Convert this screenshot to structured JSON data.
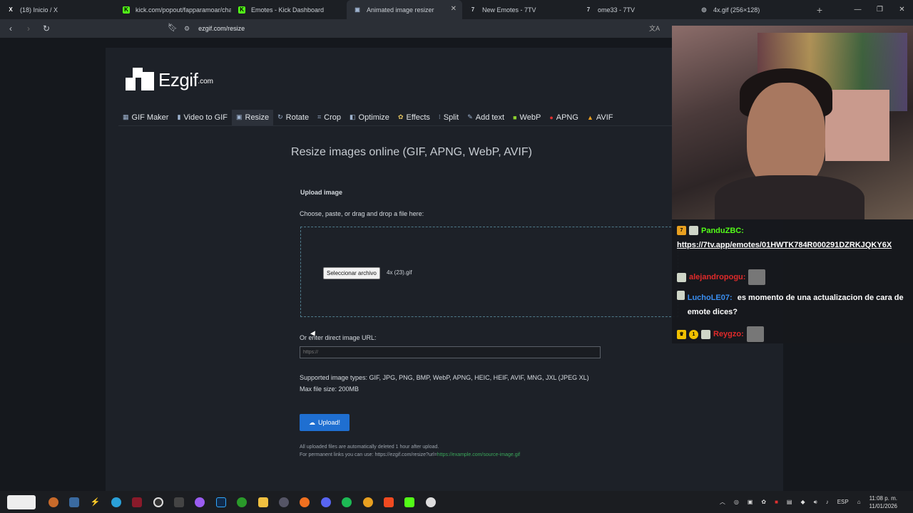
{
  "tabs": [
    {
      "label": "(18) Inicio / X",
      "favicon": "X",
      "color": "#ffffff"
    },
    {
      "label": "kick.com/popout/fapparamoar/chat",
      "favicon": "K",
      "color": "#53fc18"
    },
    {
      "label": "Emotes - Kick Dashboard",
      "favicon": "K",
      "color": "#53fc18"
    },
    {
      "label": "Animated image resizer",
      "favicon": "▣",
      "color": "#9fb4d0",
      "active": true
    },
    {
      "label": "New Emotes - 7TV",
      "favicon": "7",
      "color": "#cccccc"
    },
    {
      "label": "ome33 - 7TV",
      "favicon": "7",
      "color": "#cccccc"
    },
    {
      "label": "4x.gif (256×128)",
      "favicon": "◎",
      "color": "#cccccc"
    }
  ],
  "address": "ezgif.com/resize",
  "logo": {
    "name": "Ezgif",
    "suffix": ".com"
  },
  "menu": [
    {
      "label": "GIF Maker",
      "icon": "gif-maker-icon"
    },
    {
      "label": "Video to GIF",
      "icon": "video-icon"
    },
    {
      "label": "Resize",
      "icon": "resize-icon",
      "active": true
    },
    {
      "label": "Rotate",
      "icon": "rotate-icon"
    },
    {
      "label": "Crop",
      "icon": "crop-icon"
    },
    {
      "label": "Optimize",
      "icon": "optimize-icon"
    },
    {
      "label": "Effects",
      "icon": "effects-icon"
    },
    {
      "label": "Split",
      "icon": "split-icon"
    },
    {
      "label": "Add text",
      "icon": "text-icon"
    },
    {
      "label": "WebP",
      "icon": "webp-icon"
    },
    {
      "label": "APNG",
      "icon": "apng-icon"
    },
    {
      "label": "AVIF",
      "icon": "avif-icon"
    }
  ],
  "main": {
    "heading": "Resize images online (GIF, APNG, WebP, AVIF)",
    "upload_title": "Upload image",
    "choose_text": "Choose, paste, or drag and drop a file here:",
    "file_button": "Seleccionar archivo",
    "file_name": "4x (23).gif",
    "url_label": "Or enter direct image URL:",
    "url_placeholder": "https://",
    "supported": "Supported image types: GIF, JPG, PNG, BMP, WebP, APNG, HEIC, HEIF, AVIF, MNG, JXL (JPEG XL)",
    "max_size": "Max file size: 200MB",
    "upload_button": "Upload!",
    "note1": "All uploaded files are automatically deleted 1 hour after upload.",
    "note2_prefix": "For permanent links you can use: https://ezgif.com/resize?url=",
    "note2_link": "https://example.com/source-image.gif"
  },
  "chat": [
    {
      "user": "PanduZBC:",
      "user_color": "#53fc18",
      "message": "https://7tv.app/emotes/01HWTK784R000291DZRKJQKY6X"
    },
    {
      "user": "alejandropogu:",
      "user_color": "#e02a2a",
      "message": ""
    },
    {
      "user": "LuchoLE07:",
      "user_color": "#3a8ef0",
      "message": "es momento de una actualizacion de cara de emote dices?"
    },
    {
      "user": "Reygzo:",
      "user_color": "#e02a2a",
      "message": ""
    }
  ],
  "tray": {
    "lang": "ESP",
    "time": "11:08 p. m.",
    "date": "11/01/2026"
  }
}
